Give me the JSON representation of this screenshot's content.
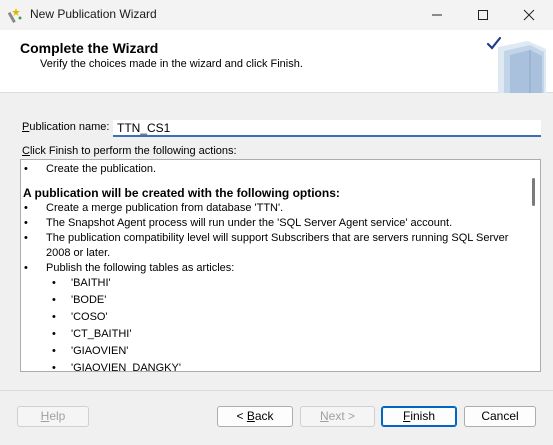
{
  "window": {
    "title": "New Publication Wizard",
    "icon": "wizard-wand-icon"
  },
  "header": {
    "title": "Complete the Wizard",
    "subtitle": "Verify the choices made in the wizard and click Finish."
  },
  "publication": {
    "label_hotkey": "P",
    "label_rest": "ublication name:",
    "value": "TTN_CS1"
  },
  "actions": {
    "label_hotkey": "C",
    "label_rest": "lick Finish to perform the following actions:",
    "first_item": "Create the publication.",
    "heading": "A publication will be created with the following options:",
    "options": [
      "Create a merge publication from database 'TTN'.",
      "The Snapshot Agent process will run under the 'SQL Server Agent service' account.",
      "The publication compatibility level will support Subscribers that are servers running SQL Server 2008 or later.",
      "Publish the following tables as articles:"
    ],
    "tables": [
      "'BAITHI'",
      "'BODE'",
      "'COSO'",
      "'CT_BAITHI'",
      "'GIAOVIEN'",
      "'GIAOVIEN_DANGKY'"
    ]
  },
  "buttons": {
    "help": {
      "hotkey": "H",
      "rest": "elp"
    },
    "back": {
      "prefix": "< ",
      "hotkey": "B",
      "rest": "ack"
    },
    "next": {
      "hotkey": "N",
      "rest": "ext >"
    },
    "finish": {
      "hotkey": "F",
      "rest": "inish"
    },
    "cancel": "Cancel"
  },
  "colors": {
    "accent": "#0067c0",
    "input_underline": "#3b6fb6"
  }
}
